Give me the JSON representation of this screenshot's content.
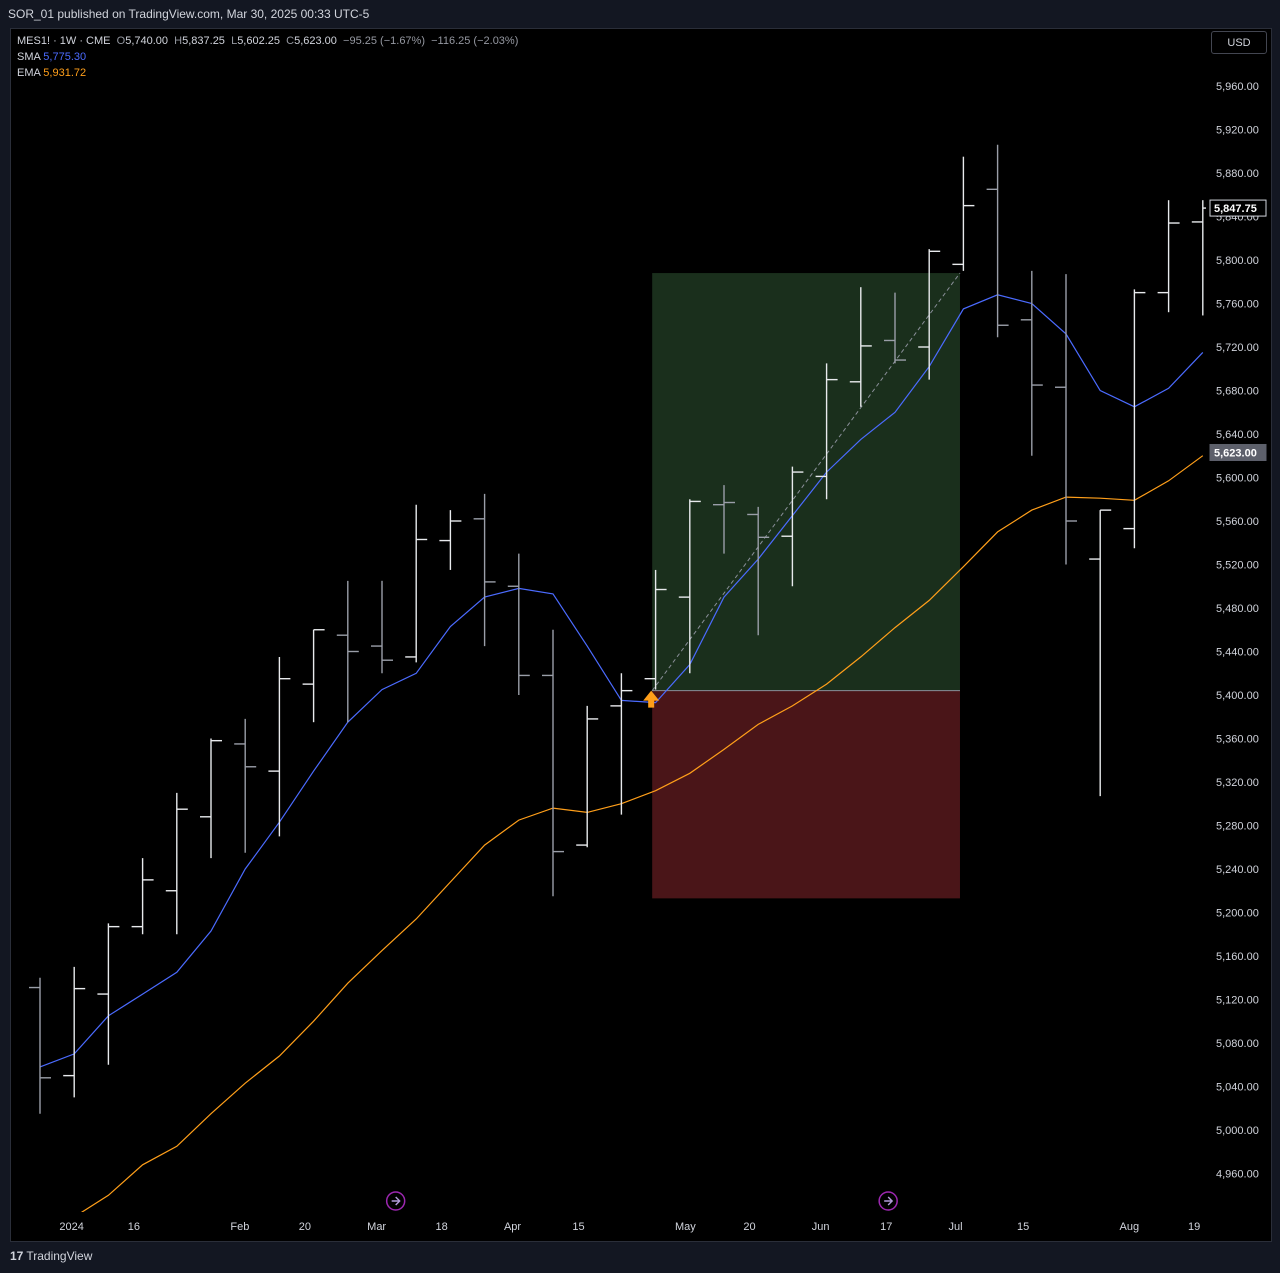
{
  "header": {
    "published_text": "SOR_01 published on TradingView.com, Mar 30, 2025 00:33 UTC-5"
  },
  "legend": {
    "symbol": "MES1! · 1W · CME",
    "ohlc": [
      {
        "label": "O",
        "value": "5,740.00"
      },
      {
        "label": "H",
        "value": "5,837.25"
      },
      {
        "label": "L",
        "value": "5,602.25"
      },
      {
        "label": "C",
        "value": "5,623.00"
      }
    ],
    "change": "−95.25 (−1.67%)",
    "change2": "−116.25 (−2.03%)",
    "sma_label": "SMA",
    "sma_value": "5,775.30",
    "ema_label": "EMA",
    "ema_value": "5,931.72"
  },
  "currency_button": "USD",
  "footer": {
    "brand": "TradingView",
    "logo_glyph": "17"
  },
  "colors": {
    "sma": "#4b6bff",
    "ema": "#ff9f1a",
    "bar": "#d1d4dc",
    "profit_zone": "#1a2f1c",
    "loss_zone": "#4a1518"
  },
  "chart_data": {
    "type": "line",
    "chart_style": "ohlc-bars",
    "y_ticks": [
      4960,
      5000,
      5040,
      5080,
      5120,
      5160,
      5200,
      5240,
      5280,
      5320,
      5360,
      5400,
      5440,
      5480,
      5520,
      5560,
      5600,
      5640,
      5680,
      5720,
      5760,
      5800,
      5840,
      5880,
      5920,
      5960
    ],
    "y_tick_labels": [
      "4,960.00",
      "5,000.00",
      "5,040.00",
      "5,080.00",
      "5,120.00",
      "5,160.00",
      "5,200.00",
      "5,240.00",
      "5,280.00",
      "5,320.00",
      "5,360.00",
      "5,400.00",
      "5,440.00",
      "5,480.00",
      "5,520.00",
      "5,560.00",
      "5,600.00",
      "5,640.00",
      "5,680.00",
      "5,720.00",
      "5,760.00",
      "5,800.00",
      "5,840.00",
      "5,880.00",
      "5,920.00",
      "5,960.00"
    ],
    "ylim": [
      4930,
      6000
    ],
    "x_labels": [
      {
        "text": "2024",
        "bar": 0.8
      },
      {
        "text": "16",
        "bar": 2.8
      },
      {
        "text": "Feb",
        "bar": 5.8
      },
      {
        "text": "20",
        "bar": 7.8
      },
      {
        "text": "Mar",
        "bar": 9.8
      },
      {
        "text": "18",
        "bar": 11.8
      },
      {
        "text": "Apr",
        "bar": 13.8
      },
      {
        "text": "15",
        "bar": 15.8
      },
      {
        "text": "May",
        "bar": 18.8
      },
      {
        "text": "20",
        "bar": 20.8
      },
      {
        "text": "Jun",
        "bar": 22.8
      },
      {
        "text": "17",
        "bar": 24.8
      },
      {
        "text": "Jul",
        "bar": 26.8
      },
      {
        "text": "15",
        "bar": 28.8
      },
      {
        "text": "Aug",
        "bar": 31.8
      },
      {
        "text": "19",
        "bar": 33.8
      }
    ],
    "bars": [
      {
        "o": 5131,
        "h": 5140,
        "l": 5015,
        "c": 5048,
        "up": false
      },
      {
        "o": 5050,
        "h": 5150,
        "l": 5030,
        "c": 5130,
        "up": true
      },
      {
        "o": 5125,
        "h": 5190,
        "l": 5060,
        "c": 5187,
        "up": true
      },
      {
        "o": 5187,
        "h": 5250,
        "l": 5180,
        "c": 5230,
        "up": true
      },
      {
        "o": 5220,
        "h": 5310,
        "l": 5180,
        "c": 5295,
        "up": true
      },
      {
        "o": 5288,
        "h": 5360,
        "l": 5250,
        "c": 5358,
        "up": true
      },
      {
        "o": 5355,
        "h": 5378,
        "l": 5255,
        "c": 5334,
        "up": false
      },
      {
        "o": 5330,
        "h": 5435,
        "l": 5270,
        "c": 5415,
        "up": true
      },
      {
        "o": 5410,
        "h": 5460,
        "l": 5375,
        "c": 5460,
        "up": true
      },
      {
        "o": 5455,
        "h": 5505,
        "l": 5375,
        "c": 5440,
        "up": false
      },
      {
        "o": 5445,
        "h": 5505,
        "l": 5420,
        "c": 5432,
        "up": false
      },
      {
        "o": 5435,
        "h": 5575,
        "l": 5430,
        "c": 5543,
        "up": true
      },
      {
        "o": 5542,
        "h": 5570,
        "l": 5515,
        "c": 5560,
        "up": true
      },
      {
        "o": 5562,
        "h": 5585,
        "l": 5445,
        "c": 5504,
        "up": false
      },
      {
        "o": 5500,
        "h": 5530,
        "l": 5400,
        "c": 5418,
        "up": false
      },
      {
        "o": 5418,
        "h": 5460,
        "l": 5215,
        "c": 5256,
        "up": false
      },
      {
        "o": 5262,
        "h": 5390,
        "l": 5260,
        "c": 5378,
        "up": true
      },
      {
        "o": 5390,
        "h": 5420,
        "l": 5290,
        "c": 5404,
        "up": true
      },
      {
        "o": 5415,
        "h": 5515,
        "l": 5405,
        "c": 5497,
        "up": true
      },
      {
        "o": 5490,
        "h": 5580,
        "l": 5420,
        "c": 5578,
        "up": true
      },
      {
        "o": 5575,
        "h": 5593,
        "l": 5530,
        "c": 5577,
        "up": false
      },
      {
        "o": 5566,
        "h": 5573,
        "l": 5455,
        "c": 5545,
        "up": false
      },
      {
        "o": 5546,
        "h": 5610,
        "l": 5500,
        "c": 5605,
        "up": true
      },
      {
        "o": 5601,
        "h": 5705,
        "l": 5580,
        "c": 5690,
        "up": true
      },
      {
        "o": 5688,
        "h": 5775,
        "l": 5665,
        "c": 5721,
        "up": true
      },
      {
        "o": 5726,
        "h": 5770,
        "l": 5705,
        "c": 5708,
        "up": false
      },
      {
        "o": 5720,
        "h": 5810,
        "l": 5690,
        "c": 5808,
        "up": true
      },
      {
        "o": 5796,
        "h": 5895,
        "l": 5790,
        "c": 5850,
        "up": true
      },
      {
        "o": 5865,
        "h": 5906,
        "l": 5729,
        "c": 5740,
        "up": false
      },
      {
        "o": 5745,
        "h": 5790,
        "l": 5620,
        "c": 5685,
        "up": false
      },
      {
        "o": 5683,
        "h": 5787,
        "l": 5520,
        "c": 5560,
        "up": false
      },
      {
        "o": 5525,
        "h": 5570,
        "l": 5307,
        "c": 5570,
        "up": true
      },
      {
        "o": 5553,
        "h": 5773,
        "l": 5535,
        "c": 5770,
        "up": true
      },
      {
        "o": 5770,
        "h": 5855,
        "l": 5752,
        "c": 5834,
        "up": true
      },
      {
        "o": 5835,
        "h": 5855,
        "l": 5749,
        "c": 5847.75,
        "up": true
      }
    ],
    "series": [
      {
        "name": "SMA",
        "values": [
          5058,
          5070,
          5105,
          5125,
          5145,
          5183,
          5240,
          5283,
          5330,
          5375,
          5405,
          5420,
          5463,
          5490,
          5498,
          5493,
          5445,
          5395,
          5393,
          5428,
          5490,
          5525,
          5565,
          5605,
          5635,
          5660,
          5702,
          5755,
          5768,
          5760,
          5732,
          5680,
          5665,
          5682,
          5715
        ]
      },
      {
        "name": "EMA",
        "values": [
          4900,
          4920,
          4940,
          4968,
          4985,
          5015,
          5043,
          5068,
          5100,
          5135,
          5165,
          5194,
          5228,
          5262,
          5285,
          5296,
          5292,
          5300,
          5312,
          5328,
          5350,
          5373,
          5390,
          5410,
          5435,
          5462,
          5487,
          5518,
          5550,
          5570,
          5582,
          5581,
          5579,
          5597,
          5620
        ]
      }
    ],
    "last_price_label": "5,847.75",
    "close_label": "5,623.00",
    "position": {
      "entry": 5404,
      "target": 5788,
      "stop": 5213,
      "start_bar": 17.9,
      "end_bar": 26.9
    }
  }
}
